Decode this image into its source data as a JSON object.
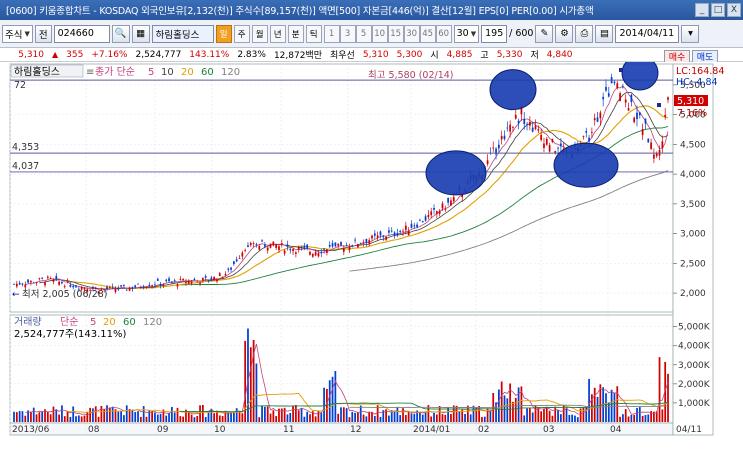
{
  "window": {
    "title": "[0600] 키움종합차트 - KOSDAQ 외국인보유[2,132(천)] 주식수[89,157(천)] 액면[500] 자본금[446(억)] 결산[12월] EPS[0] PER[0.00] 시가총액",
    "btn_min": "_",
    "btn_max": "□",
    "btn_close": "X"
  },
  "toolbar": {
    "type_label": "주식",
    "prev_label": "전",
    "code": "024660",
    "name": "하림홀딩스",
    "period_day": "일",
    "period_week": "주",
    "period_month": "월",
    "period_year": "년",
    "period_minute": "분",
    "period_tick": "틱",
    "intervals": [
      "1",
      "3",
      "5",
      "10",
      "15",
      "30",
      "45",
      "60"
    ],
    "count": "30",
    "display_count": "195",
    "total_count": "/ 600",
    "date": "2014/04/11",
    "buy_label": "매수",
    "sell_label": "매도"
  },
  "quote": {
    "price": "5,310",
    "change": "355",
    "change_pct": "+7.16%",
    "volume": "2,524,777",
    "volume_pct": "143.11%",
    "turnover_pct": "2.83%",
    "amount": "12,872백만",
    "open_label": "최우선",
    "best": "5,310",
    "best2": "5,300",
    "open_text": "시",
    "open": "4,885",
    "high_text": "고",
    "high": "5,330",
    "low_text": "저",
    "low": "4,840"
  },
  "price_panel": {
    "stock_label": "하림홀딩스",
    "ma_label": "종가 단순",
    "ma_periods": [
      "5",
      "10",
      "20",
      "60",
      "120"
    ],
    "level_top": "72",
    "level1": "4,353",
    "level2": "4,037",
    "high_annotation": "최고 5,580 (02/14)",
    "low_annotation": "최저 2,005 (06/28)",
    "right_lc": "LC:164.84",
    "right_hc": "HC:-4.84",
    "right_price": "5,310",
    "right_pct": "7.16%",
    "y_ticks": [
      "5,500",
      "5,000",
      "4,500",
      "4,000",
      "3,500",
      "3,000",
      "2,500",
      "2,000"
    ]
  },
  "volume_panel": {
    "label": "거래량",
    "ma_label": "단순",
    "ma_periods": [
      "5",
      "20",
      "60",
      "120"
    ],
    "value_text": "2,524,777주(143.11%)",
    "y_ticks": [
      "5,000K",
      "4,000K",
      "3,000K",
      "2,000K",
      "1,000K"
    ]
  },
  "x_axis": {
    "labels": [
      "2013/06",
      "08",
      "09",
      "10",
      "11",
      "12",
      "2014/01",
      "02",
      "03",
      "04",
      "04/11"
    ]
  },
  "colors": {
    "up": "#d00000",
    "down": "#0040d0",
    "ma5": "#c04080",
    "ma10": "#404040",
    "ma20": "#e0a000",
    "ma60": "#208040",
    "ma120": "#808080",
    "highlight": "#1a3fb0"
  }
}
